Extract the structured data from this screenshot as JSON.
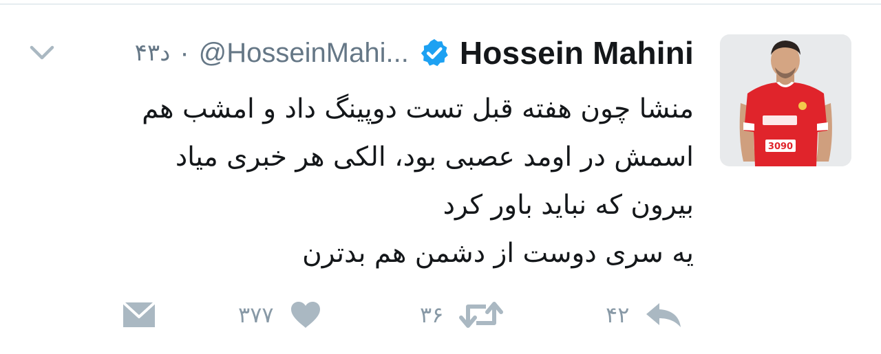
{
  "tweet": {
    "display_name": "Hossein Mahini",
    "handle": "@HosseinMahi...",
    "separator": "·",
    "timestamp": "۴۳د",
    "verified": true,
    "text_lines": [
      "منشا چون هفته قبل تست دوپینگ داد و امشب هم",
      "اسمش در اومد عصبی بود، الکی هر خبری میاد",
      "بیرون که نباید باور کرد",
      "یه سری دوست از دشمن هم بدترن"
    ],
    "avatar_jersey_number": "3090"
  },
  "actions": {
    "reply_count": "۴۲",
    "retweet_count": "۳۶",
    "like_count": "۳۷۷"
  },
  "icons": {
    "reply": "reply-icon",
    "retweet": "retweet-icon",
    "like": "heart-icon",
    "dm": "direct-message-icon",
    "caret": "chevron-down-icon",
    "verified": "verified-badge-icon"
  },
  "colors": {
    "text": "#14171a",
    "secondary": "#657786",
    "action_icon": "#aab8c2",
    "verified": "#1da1f2",
    "jersey": "#e0242b"
  }
}
